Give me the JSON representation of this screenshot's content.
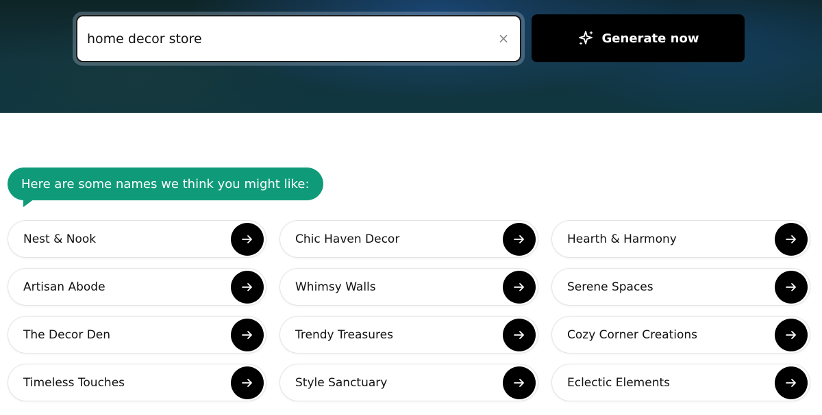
{
  "search": {
    "value": "home decor store",
    "clear_icon": "close-icon"
  },
  "generate_button": {
    "label": "Generate now",
    "icon": "sparkle-icon"
  },
  "results": {
    "intro": "Here are some names we think you might like:",
    "accent_color": "#0f9b7a",
    "names": [
      "Nest & Nook",
      "Chic Haven Decor",
      "Hearth & Harmony",
      "Artisan Abode",
      "Whimsy Walls",
      "Serene Spaces",
      "The Decor Den",
      "Trendy Treasures",
      "Cozy Corner Creations",
      "Timeless Touches",
      "Style Sanctuary",
      "Eclectic Elements"
    ],
    "item_icon": "arrow-right-icon"
  }
}
